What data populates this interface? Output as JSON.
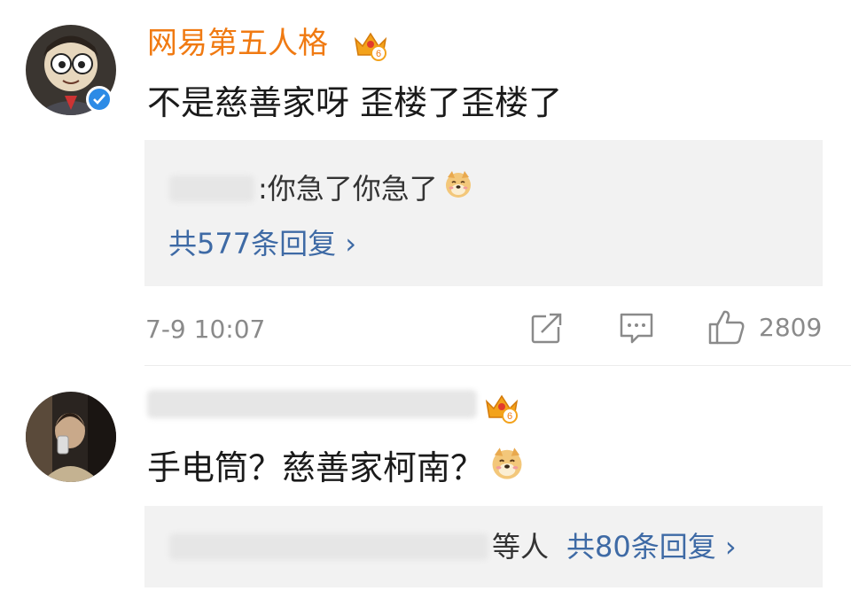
{
  "comments": [
    {
      "username": "网易第五人格",
      "vip_badge": "6",
      "verified": true,
      "text": "不是慈善家呀 歪楼了歪楼了",
      "reply_preview": {
        "text": ":你急了你急了",
        "emoji": "doge-emoji"
      },
      "replies_link": "共577条回复 ›",
      "timestamp": "7-9 10:07",
      "likes": "2809"
    },
    {
      "vip_badge": "6",
      "text": "手电筒？慈善家柯南？",
      "emoji": "doge-emoji",
      "reply_suffix": "等人",
      "replies_link": "共80条回复 ›"
    }
  ],
  "colors": {
    "vip_name": "#f07a12",
    "link": "#3e6aa5",
    "verified": "#2c8be6",
    "reply_bg": "#f2f2f2"
  }
}
